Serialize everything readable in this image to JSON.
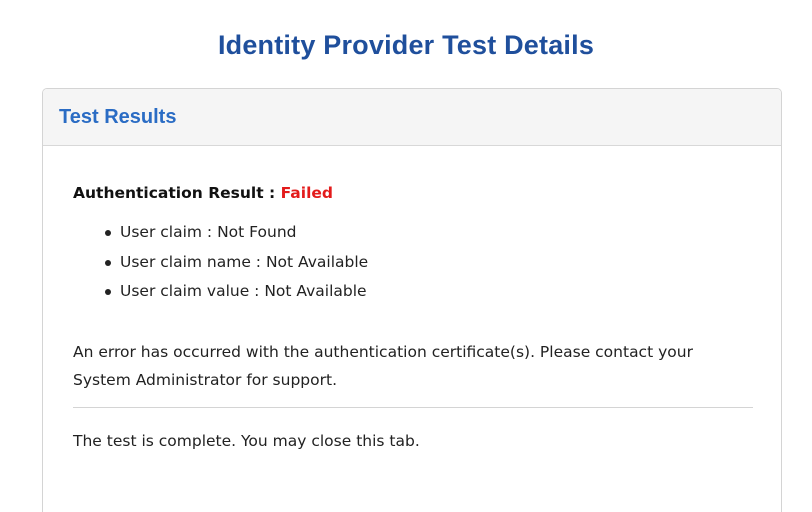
{
  "page": {
    "title": "Identity Provider Test Details"
  },
  "panel": {
    "title": "Test Results",
    "auth_result_label": "Authentication Result : ",
    "auth_result_value": "Failed",
    "claims": [
      "User claim : Not Found",
      "User claim name : Not Available",
      "User claim value : Not Available"
    ],
    "error_message": "An error has occurred with the authentication certificate(s). Please contact your System Administrator for support.",
    "complete_message": "The test is complete. You may close this tab."
  },
  "colors": {
    "title": "#1f4f9c",
    "panel_title": "#2a6cc4",
    "failed": "#e31b1b",
    "header_bg": "#f5f5f5",
    "border": "#d4d4d4"
  }
}
